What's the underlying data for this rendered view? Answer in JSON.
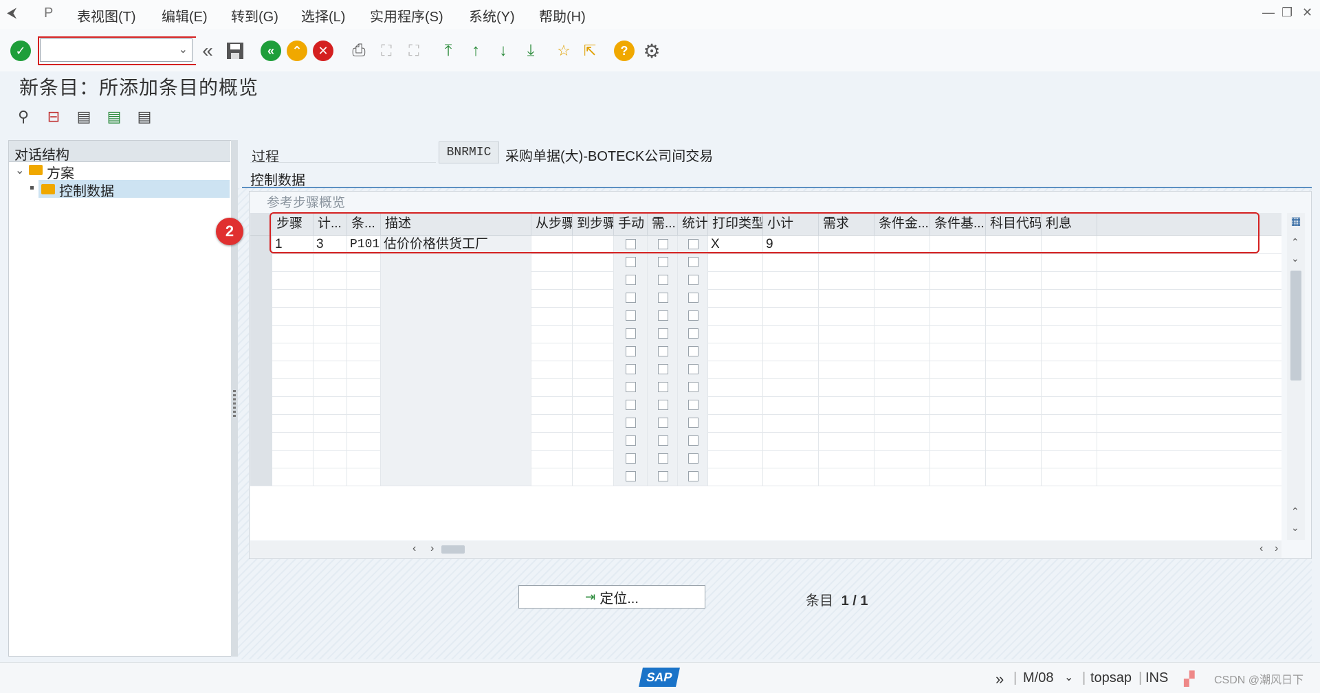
{
  "menu": {
    "items": [
      "表视图(T)",
      "编辑(E)",
      "转到(G)",
      "选择(L)",
      "实用程序(S)",
      "系统(Y)",
      "帮助(H)"
    ]
  },
  "toolbar": {
    "command_field_value": "",
    "icons": [
      "check-icon",
      "back-double-icon",
      "save-icon",
      "back-icon",
      "exit-icon",
      "cancel-icon",
      "print-icon",
      "find-icon",
      "find-next-icon",
      "first-page-icon",
      "prev-page-icon",
      "next-page-icon",
      "last-page-icon",
      "new-session-icon",
      "shortcut-icon",
      "help-icon",
      "settings-icon"
    ]
  },
  "page": {
    "title": "新条目：所添加条目的概览"
  },
  "tree": {
    "header": "对话结构",
    "items": [
      {
        "label": "方案",
        "level": 0,
        "expanded": true
      },
      {
        "label": "控制数据",
        "level": 1,
        "selected": true
      }
    ]
  },
  "process": {
    "label": "过程",
    "code": "BNRMIC",
    "description": "采购单据(大)-BOTECK公司间交易"
  },
  "section": {
    "title": "控制数据",
    "group_title": "参考步骤概览"
  },
  "table": {
    "columns": [
      "步骤",
      "计...",
      "条...",
      "描述",
      "从步骤",
      "到步骤",
      "手动",
      "需...",
      "统计",
      "打印类型",
      "小计",
      "需求",
      "条件金...",
      "条件基...",
      "科目代码",
      "利息"
    ],
    "rows": [
      {
        "step": "1",
        "counter": "3",
        "condition_type": "P101",
        "description": "估价价格供货工厂",
        "from_step": "",
        "to_step": "",
        "manual": false,
        "required": false,
        "statistical": false,
        "print_type": "X",
        "subtotal": "9",
        "requirement": "",
        "cond_amount": "",
        "cond_base": "",
        "account_key": "",
        "accrual": ""
      }
    ],
    "empty_rows": 13
  },
  "annotation": {
    "badge": "2"
  },
  "buttons": {
    "position": "定位..."
  },
  "entry": {
    "label": "条目",
    "value": "1 / 1"
  },
  "status": {
    "brand": "SAP",
    "system": "M/08",
    "server": "topsap",
    "mode": "INS",
    "watermark": "CSDN @潮风日下"
  },
  "colors": {
    "accent": "#5b8fc2",
    "highlight": "#d42020",
    "ok_green": "#1f9e3a",
    "warn_orange": "#f0a800"
  }
}
